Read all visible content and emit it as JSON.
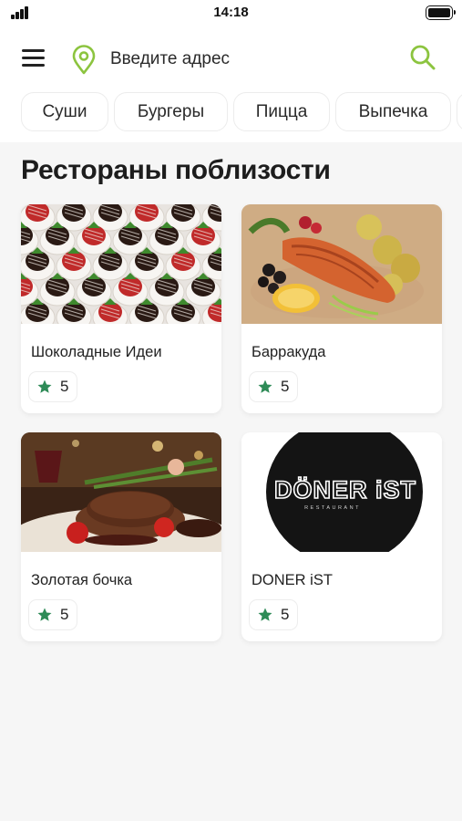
{
  "status_bar": {
    "time": "14:18"
  },
  "header": {
    "address_placeholder": "Введите адрес"
  },
  "categories": [
    "Суши",
    "Бургеры",
    "Пицца",
    "Выпечка"
  ],
  "section_title": "Рестораны поблизости",
  "restaurants": [
    {
      "name": "Шоколадные Идеи",
      "rating": "5",
      "photo": "chocolate-strawberries"
    },
    {
      "name": "Барракуда",
      "rating": "5",
      "photo": "grilled-salmon"
    },
    {
      "name": "Золотая бочка",
      "rating": "5",
      "photo": "steak-dish"
    },
    {
      "name": "DONER iST",
      "rating": "5",
      "photo": "doner-ist-logo",
      "logo_text": "DÖNER iST",
      "logo_subtext": "RESTAURANT"
    }
  ],
  "colors": {
    "accent": "#8cc43f",
    "star": "#2e8b57",
    "background": "#f6f6f6"
  }
}
